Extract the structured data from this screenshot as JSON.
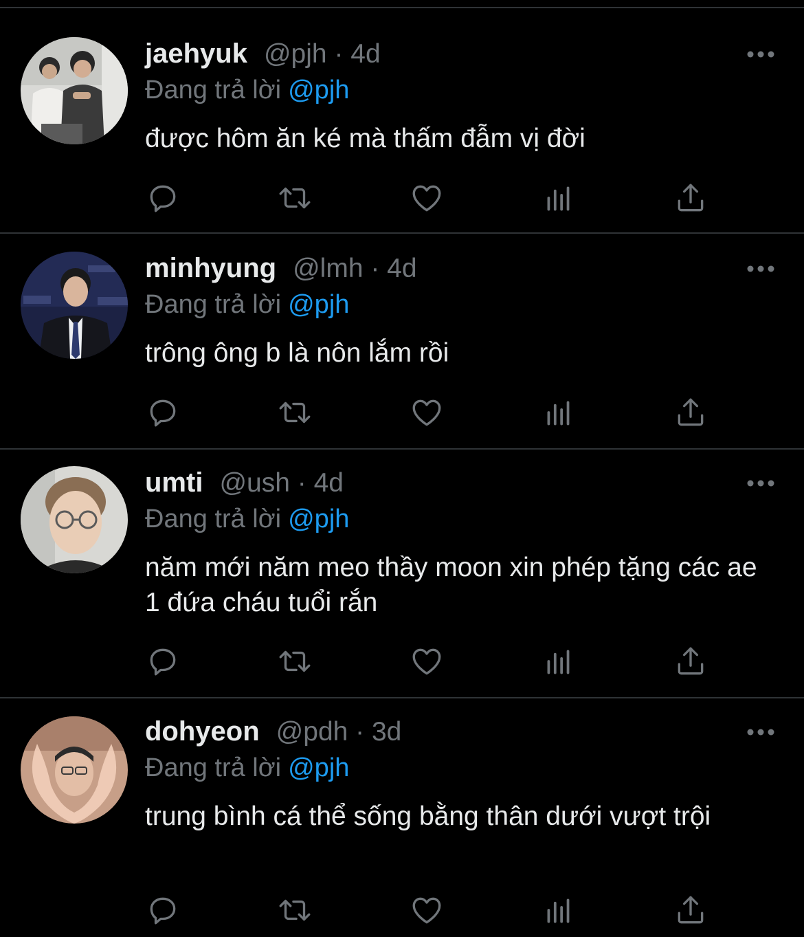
{
  "colors": {
    "background": "#000000",
    "divider": "#2f3336",
    "primary_text": "#e7e9ea",
    "secondary_text": "#71767b",
    "accent": "#1d9bf0"
  },
  "icons": {
    "reply": "reply-icon",
    "retweet": "retweet-icon",
    "like": "heart-icon",
    "views": "views-icon",
    "share": "share-icon",
    "more": "more-icon"
  },
  "tweets": [
    {
      "display_name": "jaehyuk",
      "meta": "@pjh · 4d",
      "replying_label": "Đang trả lời",
      "replying_to": "@pjh",
      "text": "được hôm ăn ké mà thấm đẫm vị đời"
    },
    {
      "display_name": "minhyung",
      "meta": "@lmh · 4d",
      "replying_label": "Đang trả lời",
      "replying_to": "@pjh",
      "text": "trông ông b là nôn lắm rồi"
    },
    {
      "display_name": "umti",
      "meta": "@ush · 4d",
      "replying_label": "Đang trả lời",
      "replying_to": "@pjh",
      "text": "năm mới năm meo thầy moon xin phép tặng các ae 1 đứa cháu tuổi rắn"
    },
    {
      "display_name": "dohyeon",
      "meta": "@pdh · 3d",
      "replying_label": "Đang trả lời",
      "replying_to": "@pjh",
      "text": "trung bình cá thể sống bằng thân dưới vượt trội"
    }
  ]
}
